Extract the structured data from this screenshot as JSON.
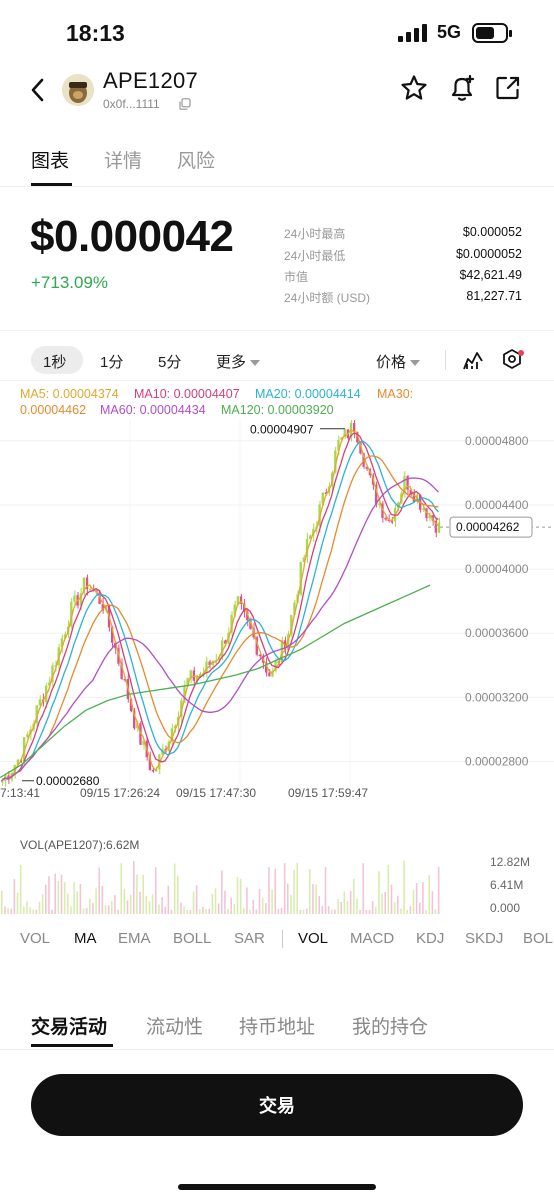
{
  "status": {
    "time": "18:13",
    "network": "5G"
  },
  "header": {
    "name": "APE1207",
    "address": "0x0f...1111"
  },
  "tabs": [
    "图表",
    "详情",
    "风险"
  ],
  "price": {
    "value": "$0.000042",
    "change": "+713.09%"
  },
  "stats": [
    {
      "label": "24小时最高",
      "value": "$0.000052"
    },
    {
      "label": "24小时最低",
      "value": "$0.0000052"
    },
    {
      "label": "市值",
      "value": "$42,621.49"
    },
    {
      "label": "24小时额 (USD)",
      "value": "81,227.71"
    }
  ],
  "intervals": [
    "1秒",
    "1分",
    "5分",
    "更多"
  ],
  "price_menu": "价格",
  "ma_legend": {
    "ma5": "MA5: 0.00004374",
    "ma10": "MA10: 0.00004407",
    "ma20": "MA20: 0.00004414",
    "ma30a": "MA30:",
    "ma30b": "0.00004462",
    "ma60": "MA60: 0.00004434",
    "ma120": "MA120: 0.00003920",
    "colors": {
      "ma5": "#e0a82e",
      "ma10": "#d4407c",
      "ma20": "#2bb3d6",
      "ma30": "#e88a2c",
      "ma60": "#b04fc6",
      "ma120": "#4caf50"
    }
  },
  "chart_data": {
    "type": "candlestick",
    "y_ticks": [
      "0.00004800",
      "0.00004400",
      "0.00004000",
      "0.00003600",
      "0.00003200",
      "0.00002800"
    ],
    "ylim": [
      2.56e-05,
      4.93e-05
    ],
    "x_ticks": [
      "7:13:41",
      "09/15 17:26:24",
      "09/15 17:47:30",
      "09/15 17:59:47"
    ],
    "high_label": "0.00004907",
    "low_label": "0.00002680",
    "last_price": "0.00004262",
    "close_path": [
      2.68e-05,
      2.82e-05,
      3.1e-05,
      3.38e-05,
      3.72e-05,
      3.92e-05,
      3.78e-05,
      3.4e-05,
      3e-05,
      2.72e-05,
      2.98e-05,
      3.3e-05,
      3.36e-05,
      3.5e-05,
      3.78e-05,
      3.56e-05,
      3.32e-05,
      3.6e-05,
      4.1e-05,
      4.4e-05,
      4.78e-05,
      4.9e-05,
      4.5e-05,
      4.3e-05,
      4.56e-05,
      4.4e-05,
      4.26e-05
    ],
    "ma120_path": [
      2.7e-05,
      2.78e-05,
      2.9e-05,
      3.02e-05,
      3.12e-05,
      3.18e-05,
      3.22e-05,
      3.24e-05,
      3.26e-05,
      3.28e-05,
      3.31e-05,
      3.34e-05,
      3.38e-05,
      3.44e-05,
      3.5e-05,
      3.58e-05,
      3.66e-05,
      3.72e-05,
      3.78e-05,
      3.84e-05,
      3.9e-05
    ]
  },
  "volume": {
    "label": "VOL(APE1207):6.62M",
    "ticks": [
      "12.82M",
      "6.41M",
      "0.000"
    ]
  },
  "indicator_tabs": [
    "VOL",
    "MA",
    "EMA",
    "BOLL",
    "SAR",
    "VOL",
    "MACD",
    "KDJ",
    "SKDJ",
    "BOL"
  ],
  "bottom_tabs": [
    "交易活动",
    "流动性",
    "持币地址",
    "我的持仓"
  ],
  "trade_button": "交易"
}
